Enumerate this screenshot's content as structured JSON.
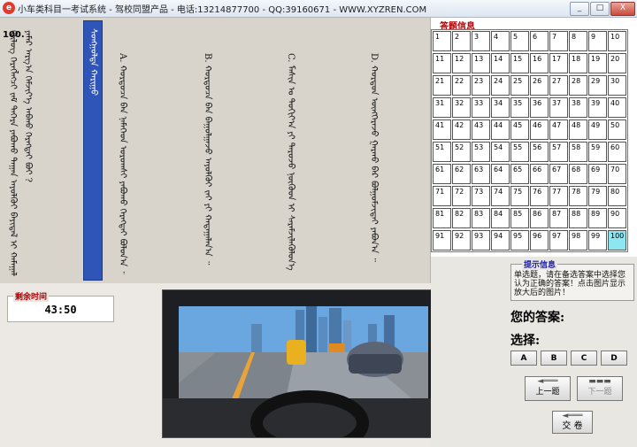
{
  "window": {
    "icon_glyph": "e",
    "title": "小车类科目一考试系统 - 驾校同盟产品 - 电话:13214877700 - QQ:39160671 - WWW.XYZREN.COM",
    "buttons": [
      "_",
      "□",
      "X"
    ]
  },
  "question": {
    "number": "100.",
    "stem_lines": [
      "ᠬᠥᠯᠥᠭ ᠬᠡᠷᠡᠭᠯᠡᠭᠴᠢ ᠵᠠᠮ ᠳᠡᠭᠡᠷᠡ ᠶᠠᠪᠤᠬᠤ ᠳᠠᠭᠠᠨ ᠠᠶᠤᠯᠭᠦᠢ ᠪᠠᠶᠢᠳᠠᠯ ᠢ ᠬᠠᠮᠠᠭᠠᠯᠠᠬᠤ ᠶᠢᠨ ᠲᠥᠯᠥᠭᠡ",
      "ᠶᠠᠮᠠᠷ ᠠᠷᠭ᠎ᠠ ᠬᠡᠮᠵᠢᠶ᠎ᠡ ᠠᠪᠬᠤ ᠬᠡᠷᠡᠭᠲᠡᠶ ᠪᠤᠢ ?"
    ],
    "selected_label": "ᠰᠣᠩᠭᠣᠯᠲᠠ ᠬᠠᠷᠢᠭᠤ",
    "options": [
      "A. ᠬᠤᠷᠳᠤᠴᠠ ᠪᠡᠨ ᠨᠡᠮᠡᠭᠡᠳ ᠤᠷᠤᠭᠰᠢ ᠶᠠᠪᠤᠬᠤ ᠬᠡᠷᠡᠭᠲᠡᠢ ᠪᠣᠯᠤᠨ᠎ᠠ ᠃",
      "B. ᠬᠤᠷᠳᠤᠴᠠ ᠪᠡᠨ ᠪᠠᠭᠤᠯᠭᠠᠵᠤ ᠠᠶᠤᠯᠭᠦᠢ ᠵᠠᠢ ᠶᠢ ᠬᠠᠳᠠᠭᠠᠯᠠᠨ᠎ᠠ ᠃",
      "C. ᠮᠠᠰᠢᠨ ᠤ ᠳᠣᠬᠢᠶ᠎ᠠ ᠶᠢ ᠳᠠᠷᠤᠵᠤ ᠨᠥᠭᠦᠳ ᠢ ᠰᠡᠷᠡᠮᠵᠢᠯᠡᠭᠦᠯᠦᠨ᠎ᠡ ᠃",
      "D. ᠬᠤᠷᠳᠤᠨ ᠥᠩᠭᠡᠷᠡᠵᠦ ᠭᠠᠷᠬᠤ ᠪᠡᠷ ᠪᠣᠯᠭᠣᠮᠵᠢᠲᠠᠢ ᠶᠠᠪᠤᠨ᠎ᠠ ᠃"
    ]
  },
  "answer_sheet": {
    "label": "答题信息",
    "cells": [
      1,
      2,
      3,
      4,
      5,
      6,
      7,
      8,
      9,
      10,
      11,
      12,
      13,
      14,
      15,
      16,
      17,
      18,
      19,
      20,
      21,
      22,
      23,
      24,
      25,
      26,
      27,
      28,
      29,
      30,
      31,
      32,
      33,
      34,
      35,
      36,
      37,
      38,
      39,
      40,
      41,
      42,
      43,
      44,
      45,
      46,
      47,
      48,
      49,
      50,
      51,
      52,
      53,
      54,
      55,
      56,
      57,
      58,
      59,
      60,
      61,
      62,
      63,
      64,
      65,
      66,
      67,
      68,
      69,
      70,
      71,
      72,
      73,
      74,
      75,
      76,
      77,
      78,
      79,
      80,
      81,
      82,
      83,
      84,
      85,
      86,
      87,
      88,
      89,
      90,
      91,
      92,
      93,
      94,
      95,
      96,
      97,
      98,
      99,
      100
    ],
    "current": 100
  },
  "tips": {
    "title": "提示信息",
    "text": "单选题，请在备选答案中选择您认为正确的答案！点击图片显示放大后的图片！"
  },
  "your_answer_label": "您的答案:",
  "choose_label": "选择:",
  "choices": [
    "A",
    "B",
    "C",
    "D"
  ],
  "nav": {
    "prev": "上一题",
    "next": "下一题",
    "submit": "交 卷"
  },
  "timer": {
    "label": "剩余时间",
    "value": "43:50"
  },
  "colors": {
    "current_cell": "#8ee6f0",
    "selected_column": "#2f55b8",
    "label_red": "#b00000"
  }
}
